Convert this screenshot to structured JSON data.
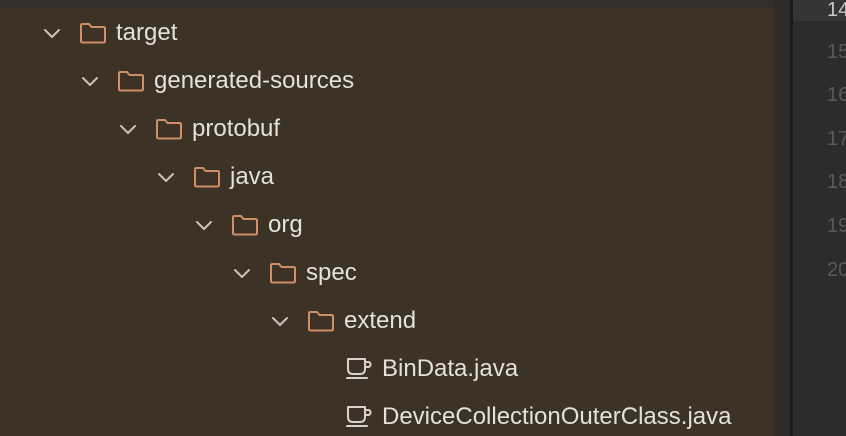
{
  "tree": {
    "items": [
      {
        "label": "target",
        "icon": "folder-icon",
        "expanded": true
      },
      {
        "label": "generated-sources",
        "icon": "folder-icon",
        "expanded": true
      },
      {
        "label": "protobuf",
        "icon": "folder-icon",
        "expanded": true
      },
      {
        "label": "java",
        "icon": "folder-icon",
        "expanded": true
      },
      {
        "label": "org",
        "icon": "folder-icon",
        "expanded": true
      },
      {
        "label": "spec",
        "icon": "folder-icon",
        "expanded": true
      },
      {
        "label": "extend",
        "icon": "folder-icon",
        "expanded": true
      },
      {
        "label": "BinData.java",
        "icon": "java-file-icon"
      },
      {
        "label": "DeviceCollectionOuterClass.java",
        "icon": "java-file-icon"
      }
    ]
  },
  "gutter": {
    "line_numbers": [
      "14",
      "15",
      "16",
      "17",
      "18",
      "19",
      "20"
    ]
  },
  "colors": {
    "panel_background": "#3d3226",
    "folder_icon": "#d08f67",
    "text": "#e4e0da",
    "chevron": "#c9c3bb",
    "gutter_background": "#2c2c2c",
    "line_number": "#595959"
  }
}
